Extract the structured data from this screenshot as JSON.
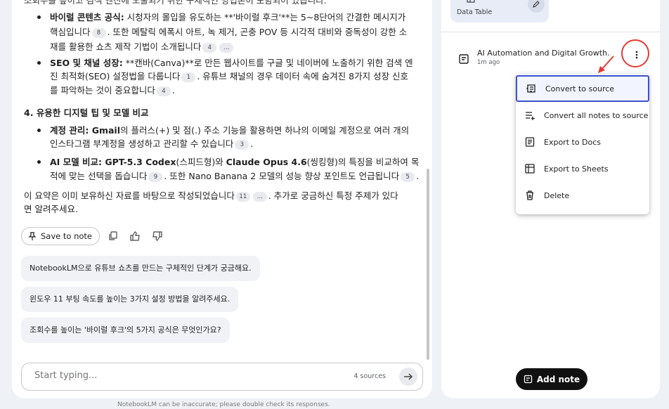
{
  "chat": {
    "lines": {
      "top_cut": "조회수를 높이고 검색 엔진에 노출되기 위한 구체적인 방법론이 포함되어 있습니다.",
      "b1_title": "바이럴 콘텐츠 공식:",
      "b1_l1": " 시청자의 몰입을 유도하는 **'바이럴 후크'**는 5~8단어의 간결한 메시지가",
      "b1_l2a": "핵심입니다",
      "b1_l2b": ". 또한 메탈릭 에폭시 아트, 녹 제거, 곤충 POV 등 시각적 대비와 중독성이 강한 소",
      "b1_l3a": "재를 활용한 쇼츠 제작 기법이 소개됩니다",
      "b2_title": "SEO 및 채널 성장:",
      "b2_l1": " **캔바(Canva)**로 만든 웹사이트를 구글 및 네이버에 노출하기 위한 검색 엔",
      "b2_l2a": "진 최적화(SEO) 설정법을 다룹니다",
      "b2_l2b": ". 유튜브 채널의 경우 데이터 속에 숨겨진 8가지 성장 신호",
      "b2_l3a": "를 파악하는 것이 중요합니다",
      "section4": "4. 유용한 디지털 팁 및 모델 비교",
      "b3_title": "계정 관리: Gmail",
      "b3_l1": "의 플러스(+) 및 점(.) 주소 기능을 활용하면 하나의 이메일 계정으로 여러 개의",
      "b3_l2a": "인스타그램 부계정을 생성하고 관리할 수 있습니다",
      "b4_title": "AI 모델 비교: GPT-5.3 Codex",
      "b4_mid": "(스피드형)와 ",
      "b4_title2": "Claude Opus 4.6",
      "b4_l1": "(씽킹형)의 특징을 비교하여 목",
      "b4_l2a": "적에 맞는 선택을 돕습니다",
      "b4_l2b": ". 또한 Nano Banana 2 모델의 성능 향상 포인트도 언급됩니다",
      "summary_l1a": "이 요약은 이미 보유하신 자료를 바탕으로 작성되었습니다",
      "summary_l1b": ". 추가로 궁금하신 특정 주제가 있다",
      "summary_l2": "면 알려주세요."
    },
    "cites": {
      "c8": "8",
      "c4a": "4",
      "c_ellipsis": "...",
      "c1": "1",
      "c4b": "4",
      "c3": "3",
      "c9": "9",
      "c5": "5",
      "c11": "11",
      "c_ellipsis2": "..."
    },
    "save_to_note": "Save to note",
    "suggestions": [
      "NotebookLM으로 유튜브 쇼츠를 만드는 구체적인 단계가 궁금해요.",
      "윈도우 11 부팅 속도를 높이는 3가지 설정 방법을 알려주세요.",
      "조회수를 높이는 '바이럴 후크'의 5가지 공식은 무엇인가요?"
    ],
    "input_placeholder": "Start typing...",
    "sources_count": "4 sources",
    "disclaimer": "NotebookLM can be inaccurate; please double check its responses."
  },
  "studio": {
    "data_table_label": "Data Table",
    "note_title": "AI Automation and Digital Growth...",
    "note_time": "1m ago",
    "menu_items": [
      "Convert to source",
      "Convert all notes to source",
      "Export to Docs",
      "Export to Sheets",
      "Delete"
    ],
    "add_note": "Add note"
  },
  "colors": {
    "highlight_border": "#3f51c8",
    "annotation_red": "#e53935"
  }
}
